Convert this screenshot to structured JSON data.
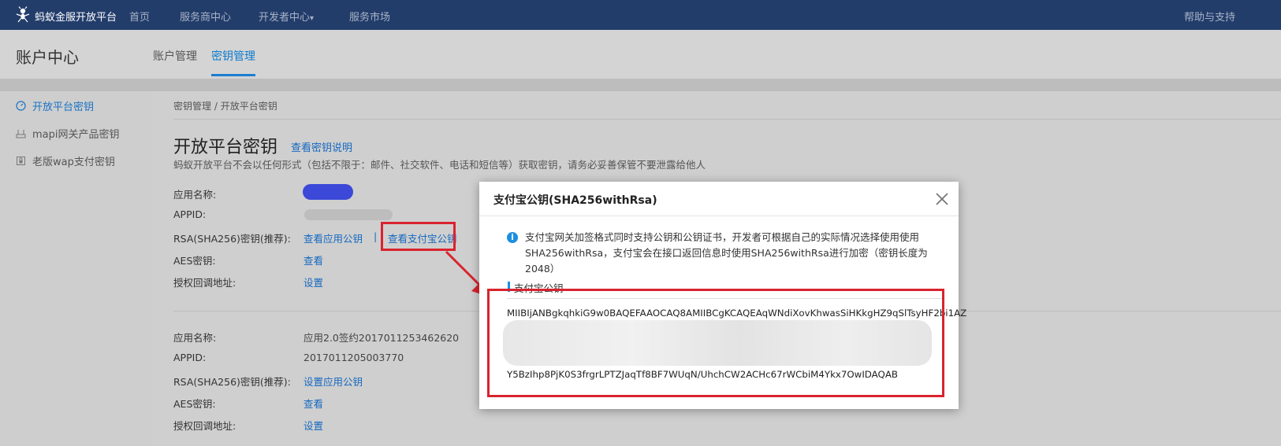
{
  "topnav": {
    "brand": "蚂蚁金服开放平台",
    "items": [
      "首页",
      "服务商中心",
      "开发者中心",
      "服务市场"
    ],
    "dev_caret": "▾",
    "right": "帮助与支持"
  },
  "subheader": {
    "title": "账户中心",
    "tabs": [
      {
        "label": "账户管理",
        "active": false
      },
      {
        "label": "密钥管理",
        "active": true
      }
    ]
  },
  "sidebar": {
    "items": [
      {
        "label": "开放平台密钥",
        "icon": "gauge-icon",
        "active": true
      },
      {
        "label": "mapi网关产品密钥",
        "icon": "network-icon",
        "active": false
      },
      {
        "label": "老版wap支付密钥",
        "icon": "lock-box-icon",
        "active": false
      }
    ]
  },
  "breadcrumb": {
    "parent": "密钥管理",
    "sep": " / ",
    "current": "开放平台密钥"
  },
  "page": {
    "title": "开放平台密钥",
    "help_link": "查看密钥说明",
    "desc": "蚂蚁开放平台不会以任何形式（包括不限于：邮件、社交软件、电话和短信等）获取密钥，请务必妥善保管不要泄露给他人"
  },
  "app1": {
    "name_label": "应用名称:",
    "appid_label": "APPID:",
    "rsa_label": "RSA(SHA256)密钥(推荐):",
    "rsa_link1": "查看应用公钥",
    "rsa_sep": "|",
    "rsa_link2": "查看支付宝公钥",
    "aes_label": "AES密钥:",
    "aes_link": "查看",
    "callback_label": "授权回调地址:",
    "callback_link": "设置"
  },
  "app2": {
    "name_label": "应用名称:",
    "name_value": "应用2.0签约2017011253462620",
    "appid_label": "APPID:",
    "appid_value": "2017011205003770",
    "rsa_label": "RSA(SHA256)密钥(推荐):",
    "rsa_link": "设置应用公钥",
    "aes_label": "AES密钥:",
    "aes_link": "查看",
    "callback_label": "授权回调地址:",
    "callback_link": "设置"
  },
  "modal": {
    "title": "支付宝公钥(SHA256withRsa)",
    "info": "支付宝网关加签格式同时支持公钥和公钥证书，开发者可根据自己的实际情况选择使用使用SHA256withRsa，支付宝会在接口返回信息时使用SHA256withRsa进行加密（密钥长度为2048）",
    "section": "支付宝公钥",
    "key_line1": "MIIBIjANBgkqhkiG9w0BAQEFAAOCAQ8AMIIBCgKCAQEAqWNdiXovKhwasSiHKkgHZ9qSlTsyHF2bi1AZ",
    "key_line_last": "Y5BzIhp8PjK0S3frgrLPTZJaqTf8BF7WUqN/UhchCW2ACHc67rWCbiM4Ykx7OwIDAQAB"
  },
  "colors": {
    "topnav_bg": "#233d6b",
    "link": "#1568c0",
    "accent": "#1b7ed0",
    "highlight": "#d9232e"
  }
}
